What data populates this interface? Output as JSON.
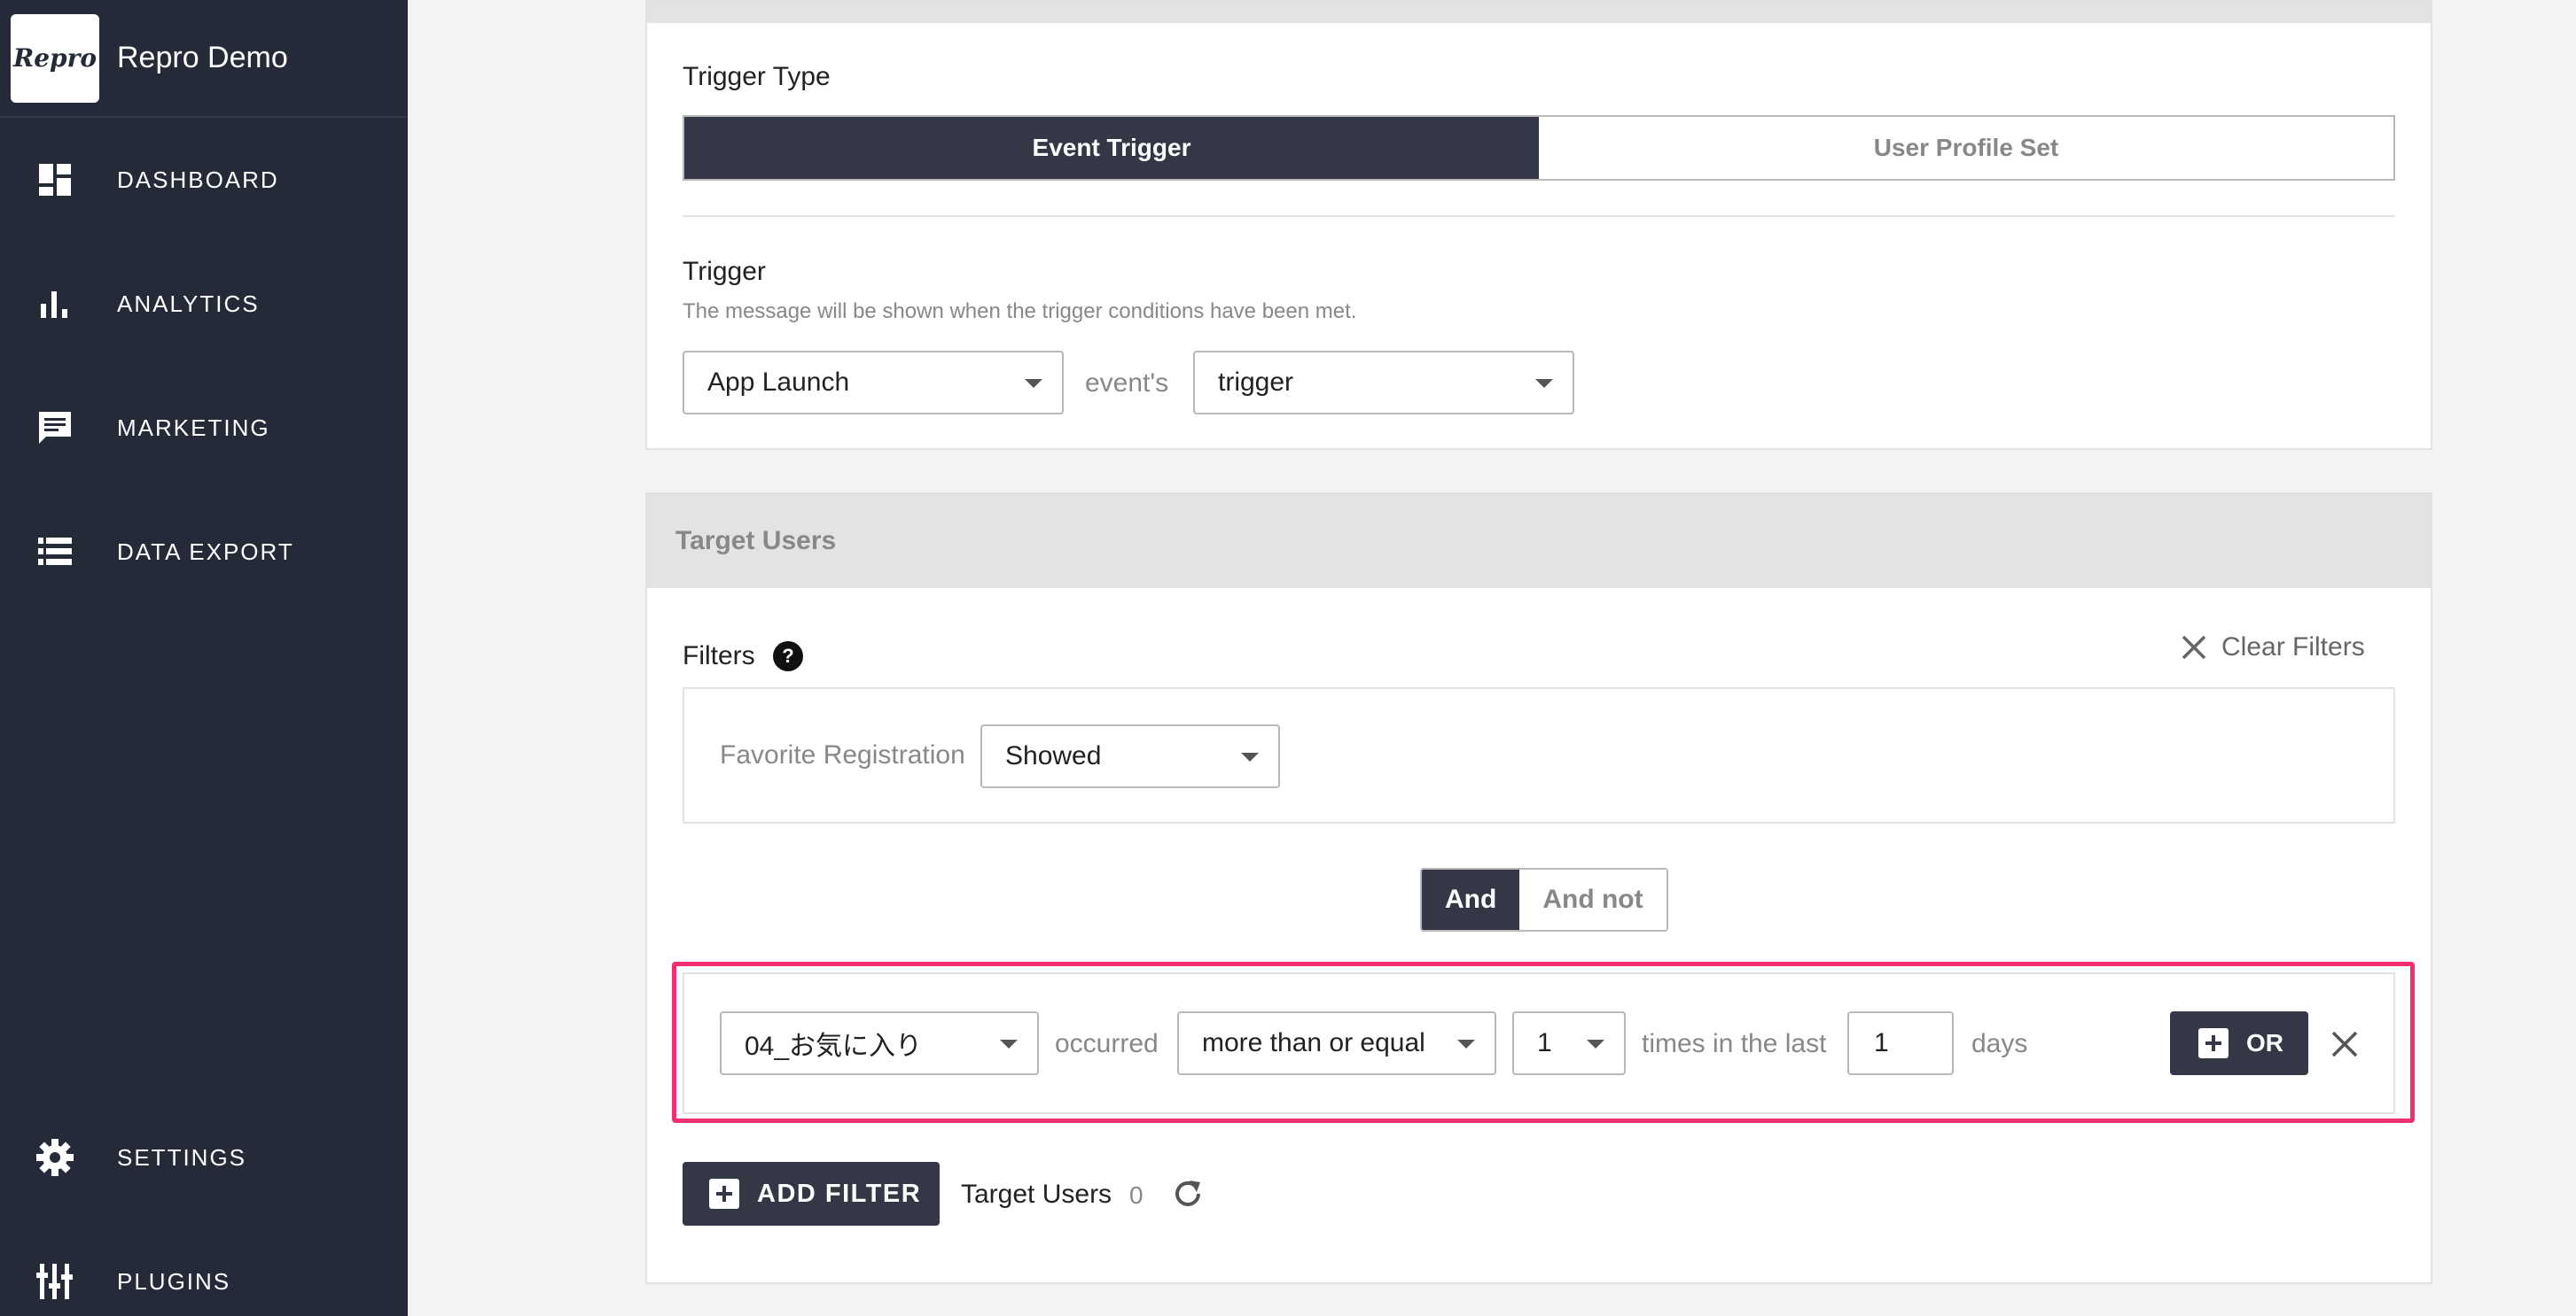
{
  "app": {
    "logo_text": "Repro",
    "name": "Repro Demo"
  },
  "sidebar": {
    "items": [
      {
        "label": "DASHBOARD",
        "icon": "dashboard-icon"
      },
      {
        "label": "ANALYTICS",
        "icon": "bar-chart-icon"
      },
      {
        "label": "MARKETING",
        "icon": "message-icon"
      },
      {
        "label": "DATA EXPORT",
        "icon": "list-icon"
      },
      {
        "label": "SETTINGS",
        "icon": "gear-icon"
      },
      {
        "label": "PLUGINS",
        "icon": "plugins-icon"
      }
    ]
  },
  "trigger_card": {
    "trigger_type_label": "Trigger Type",
    "tabs": [
      {
        "label": "Event Trigger",
        "active": true
      },
      {
        "label": "User Profile Set",
        "active": false
      }
    ],
    "trigger_label": "Trigger",
    "trigger_help": "The message will be shown when the trigger conditions have been met.",
    "event_select": "App Launch",
    "events_text": "event's",
    "trigger_select": "trigger"
  },
  "target_users": {
    "header": "Target Users",
    "filters_label": "Filters",
    "help_glyph": "?",
    "clear_filters": "Clear Filters",
    "filter1": {
      "label": "Favorite Registration",
      "value": "Showed"
    },
    "and_buttons": [
      {
        "label": "And",
        "active": true
      },
      {
        "label": "And not",
        "active": false
      }
    ],
    "filter2": {
      "event": "04_お気に入り",
      "occurred_text": "occurred",
      "comparison": "more than or equal",
      "count": "1",
      "times_text": "times in the last",
      "days_value": "1",
      "days_text": "days",
      "or_button": "OR"
    },
    "add_filter": "ADD FILTER",
    "count_label": "Target Users",
    "count_value": "0"
  },
  "colors": {
    "sidebar_bg": "#252a39",
    "accent_dark": "#343846",
    "highlight": "#ef2f74"
  }
}
